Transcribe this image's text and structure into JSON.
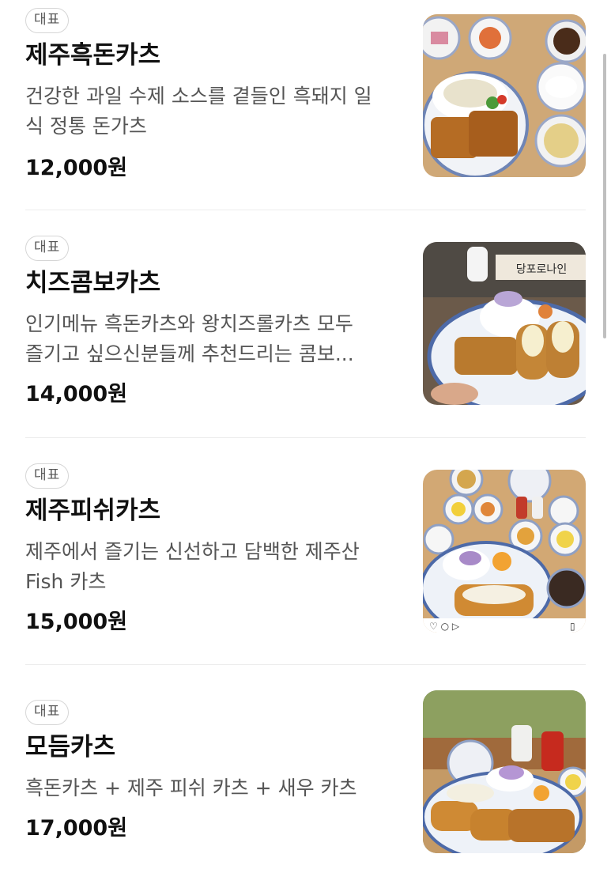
{
  "menu": {
    "items": [
      {
        "badge": "대표",
        "name": "제주흑돈카츠",
        "description_line1": "건강한 과일 수제 소스를 곁들인 흑돼지 일",
        "description_line2": "식 정통 돈가츠",
        "price": "12,000원",
        "image": "black-pork-katsu-set-photo"
      },
      {
        "badge": "대표",
        "name": "치즈콤보카츠",
        "description_line1": "인기메뉴 흑돈카츠와 왕치즈롤카츠 모두",
        "description_line2": "즐기고 싶으신분들께 추천드리는 콤보...",
        "price": "14,000원",
        "image": "cheese-combo-katsu-photo",
        "image_sign_text": "당포로나인"
      },
      {
        "badge": "대표",
        "name": "제주피쉬카츠",
        "description_line1": "제주에서 즐기는 신선하고 담백한 제주산",
        "description_line2": "Fish 카츠",
        "price": "15,000원",
        "image": "fish-katsu-photo"
      },
      {
        "badge": "대표",
        "name": "모듬카츠",
        "description_line1": "흑돈카츠 + 제주 피쉬 카츠 + 새우 카츠",
        "description_line2": "",
        "price": "17,000원",
        "image": "assorted-katsu-photo"
      }
    ]
  },
  "colors": {
    "text_primary": "#111111",
    "text_secondary": "#555555",
    "badge_border": "#d6d6d6",
    "divider": "#ececec"
  }
}
